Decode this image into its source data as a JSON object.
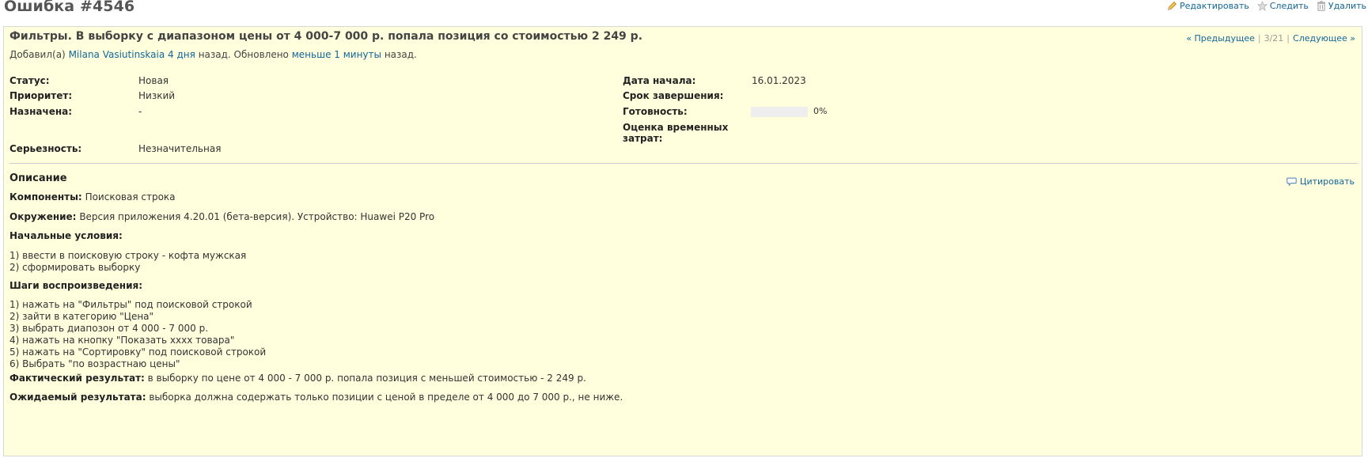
{
  "issue": {
    "title": "Ошибка #4546",
    "subject": "Фильтры. В выборку с диапазоном цены от 4 000-7 000 р. попала позиция со стоимостью 2 249 р.",
    "author_prefix": "Добавил(а)",
    "author_name": "Milana Vasiutinskaia",
    "added_ago": "4 дня",
    "after_added": "назад. Обновлено",
    "updated_ago": "меньше 1 минуты",
    "after_updated": "назад."
  },
  "actions": {
    "edit": "Редактировать",
    "watch": "Следить",
    "delete": "Удалить"
  },
  "nav": {
    "previous": "« Предыдущее",
    "position": "3/21",
    "next": "Следующее »",
    "separator": "|"
  },
  "attributes": {
    "status_label": "Статус:",
    "status_value": "Новая",
    "priority_label": "Приоритет:",
    "priority_value": "Низкий",
    "assigned_label": "Назначена:",
    "assigned_value": "-",
    "severity_label": "Серьезность:",
    "severity_value": "Незначительная",
    "start_label": "Дата начала:",
    "start_value": "16.01.2023",
    "due_label": "Срок завершения:",
    "due_value": "",
    "done_label": "Готовность:",
    "done_value": "0%",
    "done_ratio": 0,
    "estimate_label": "Оценка временных затрат:",
    "estimate_value": ""
  },
  "description": {
    "heading": "Описание",
    "quote": "Цитировать",
    "components_label": "Компоненты:",
    "components_value": "Поисковая строка",
    "environment_label": "Окружение:",
    "environment_value": "Версия приложения 4.20.01 (бета-версия). Устройство: Huawei P20 Pro",
    "preconditions_label": "Начальные условия:",
    "preconditions": [
      "1) ввести в поисковую строку - кофта мужская",
      "2) сформировать выборку"
    ],
    "steps_label": "Шаги воспроизведения:",
    "steps": [
      "1) нажать на \"Фильтры\" под поисковой строкой",
      "2) зайти в категорию \"Цена\"",
      "3) выбрать диапозон от 4 000 - 7 000 р.",
      "4) нажать на кнопку \"Показать хххх товара\"",
      "5) нажать на \"Сортировку\" под поисковой строкой",
      "6) Выбрать \"по возрастнаю цены\""
    ],
    "actual_label": "Фактический результат:",
    "actual_value": "в выборку по цене от 4 000 - 7 000 р. попала позиция с меньшей стоимостью - 2 249 р.",
    "expected_label": "Ожидаемый результата:",
    "expected_value": "выборка должна содержать только позиции с ценой в пределе от 4 000 до 7 000 р., не ниже."
  },
  "icons": {
    "edit": "pencil-icon",
    "watch": "star-icon",
    "delete": "trash-icon",
    "quote": "comment-icon"
  },
  "colors": {
    "link": "#116699",
    "box_background": "#ffffdd",
    "progress_track": "#eeeeee"
  }
}
